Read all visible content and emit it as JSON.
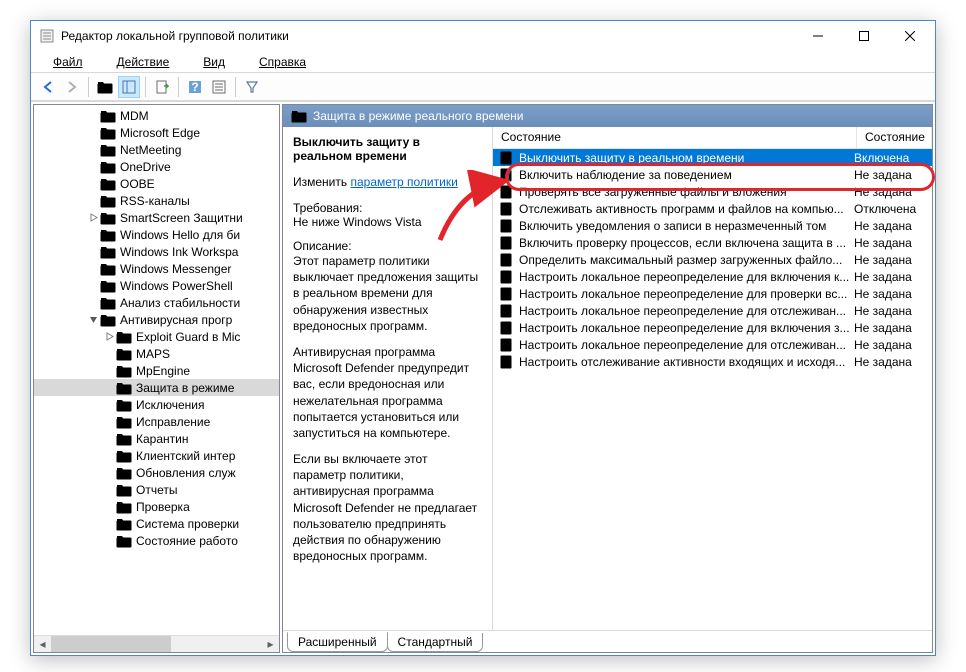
{
  "window": {
    "title": "Редактор локальной групповой политики"
  },
  "menu": {
    "file": "Файл",
    "action": "Действие",
    "view": "Вид",
    "help": "Справка"
  },
  "tree": [
    {
      "level": 3,
      "exp": "",
      "label": "MDM"
    },
    {
      "level": 3,
      "exp": "",
      "label": "Microsoft Edge"
    },
    {
      "level": 3,
      "exp": "",
      "label": "NetMeeting"
    },
    {
      "level": 3,
      "exp": "",
      "label": "OneDrive"
    },
    {
      "level": 3,
      "exp": "",
      "label": "OOBE"
    },
    {
      "level": 3,
      "exp": "",
      "label": "RSS-каналы"
    },
    {
      "level": 3,
      "exp": ">",
      "label": "SmartScreen Защитни"
    },
    {
      "level": 3,
      "exp": "",
      "label": "Windows Hello для би"
    },
    {
      "level": 3,
      "exp": "",
      "label": "Windows Ink Workspa"
    },
    {
      "level": 3,
      "exp": "",
      "label": "Windows Messenger"
    },
    {
      "level": 3,
      "exp": "",
      "label": "Windows PowerShell"
    },
    {
      "level": 3,
      "exp": "",
      "label": "Анализ стабильности"
    },
    {
      "level": 3,
      "exp": "v",
      "label": "Антивирусная прогр"
    },
    {
      "level": 4,
      "exp": ">",
      "label": "Exploit Guard в Mic"
    },
    {
      "level": 4,
      "exp": "",
      "label": "MAPS"
    },
    {
      "level": 4,
      "exp": "",
      "label": "MpEngine"
    },
    {
      "level": 4,
      "exp": "",
      "label": "Защита в режиме",
      "selected": true
    },
    {
      "level": 4,
      "exp": "",
      "label": "Исключения"
    },
    {
      "level": 4,
      "exp": "",
      "label": "Исправление"
    },
    {
      "level": 4,
      "exp": "",
      "label": "Карантин"
    },
    {
      "level": 4,
      "exp": "",
      "label": "Клиентский интер"
    },
    {
      "level": 4,
      "exp": "",
      "label": "Обновления служ"
    },
    {
      "level": 4,
      "exp": "",
      "label": "Отчеты"
    },
    {
      "level": 4,
      "exp": "",
      "label": "Проверка"
    },
    {
      "level": 4,
      "exp": "",
      "label": "Система проверки"
    },
    {
      "level": 4,
      "exp": "",
      "label": "Состояние работо"
    }
  ],
  "folder_header": "Защита в режиме реального времени",
  "detail": {
    "title": "Выключить защиту в реальном времени",
    "edit_prefix": "Изменить ",
    "edit_link": "параметр политики",
    "req_label": "Требования:",
    "req_text": "Не ниже Windows Vista",
    "desc_label": "Описание:",
    "desc_p1": "Этот параметр политики выключает предложения защиты в реальном времени для обнаружения известных вредоносных программ.",
    "desc_p2": "Антивирусная программа Microsoft Defender предупредит вас, если вредоносная или нежелательная программа попытается установиться или запуститься на компьютере.",
    "desc_p3": "Если вы включаете этот параметр политики, антивирусная программа Microsoft Defender не предлагает пользователю предпринять действия по обнаружению вредоносных программ."
  },
  "list_header": {
    "col1": "Состояние",
    "col2": "Состояние"
  },
  "policies": [
    {
      "name": "Выключить защиту в реальном времени",
      "state": "Включена",
      "selected": true
    },
    {
      "name": "Включить наблюдение за поведением",
      "state": "Не задана"
    },
    {
      "name": "Проверять все загруженные файлы и вложения",
      "state": "Не задана"
    },
    {
      "name": "Отслеживать активность программ и файлов на компью...",
      "state": "Отключена"
    },
    {
      "name": "Включить уведомления о записи в неразмеченный том",
      "state": "Не задана"
    },
    {
      "name": "Включить проверку процессов, если включена защита в ...",
      "state": "Не задана"
    },
    {
      "name": "Определить максимальный размер загруженных файло...",
      "state": "Не задана"
    },
    {
      "name": "Настроить локальное переопределение для включения к...",
      "state": "Не задана"
    },
    {
      "name": "Настроить локальное переопределение для проверки вс...",
      "state": "Не задана"
    },
    {
      "name": "Настроить локальное переопределение для отслеживан...",
      "state": "Не задана"
    },
    {
      "name": "Настроить локальное переопределение для включения з...",
      "state": "Не задана"
    },
    {
      "name": "Настроить локальное переопределение для отслеживан...",
      "state": "Не задана"
    },
    {
      "name": "Настроить отслеживание активности входящих и исходя...",
      "state": "Не задана"
    }
  ],
  "tabs": {
    "extended": "Расширенный",
    "standard": "Стандартный"
  }
}
